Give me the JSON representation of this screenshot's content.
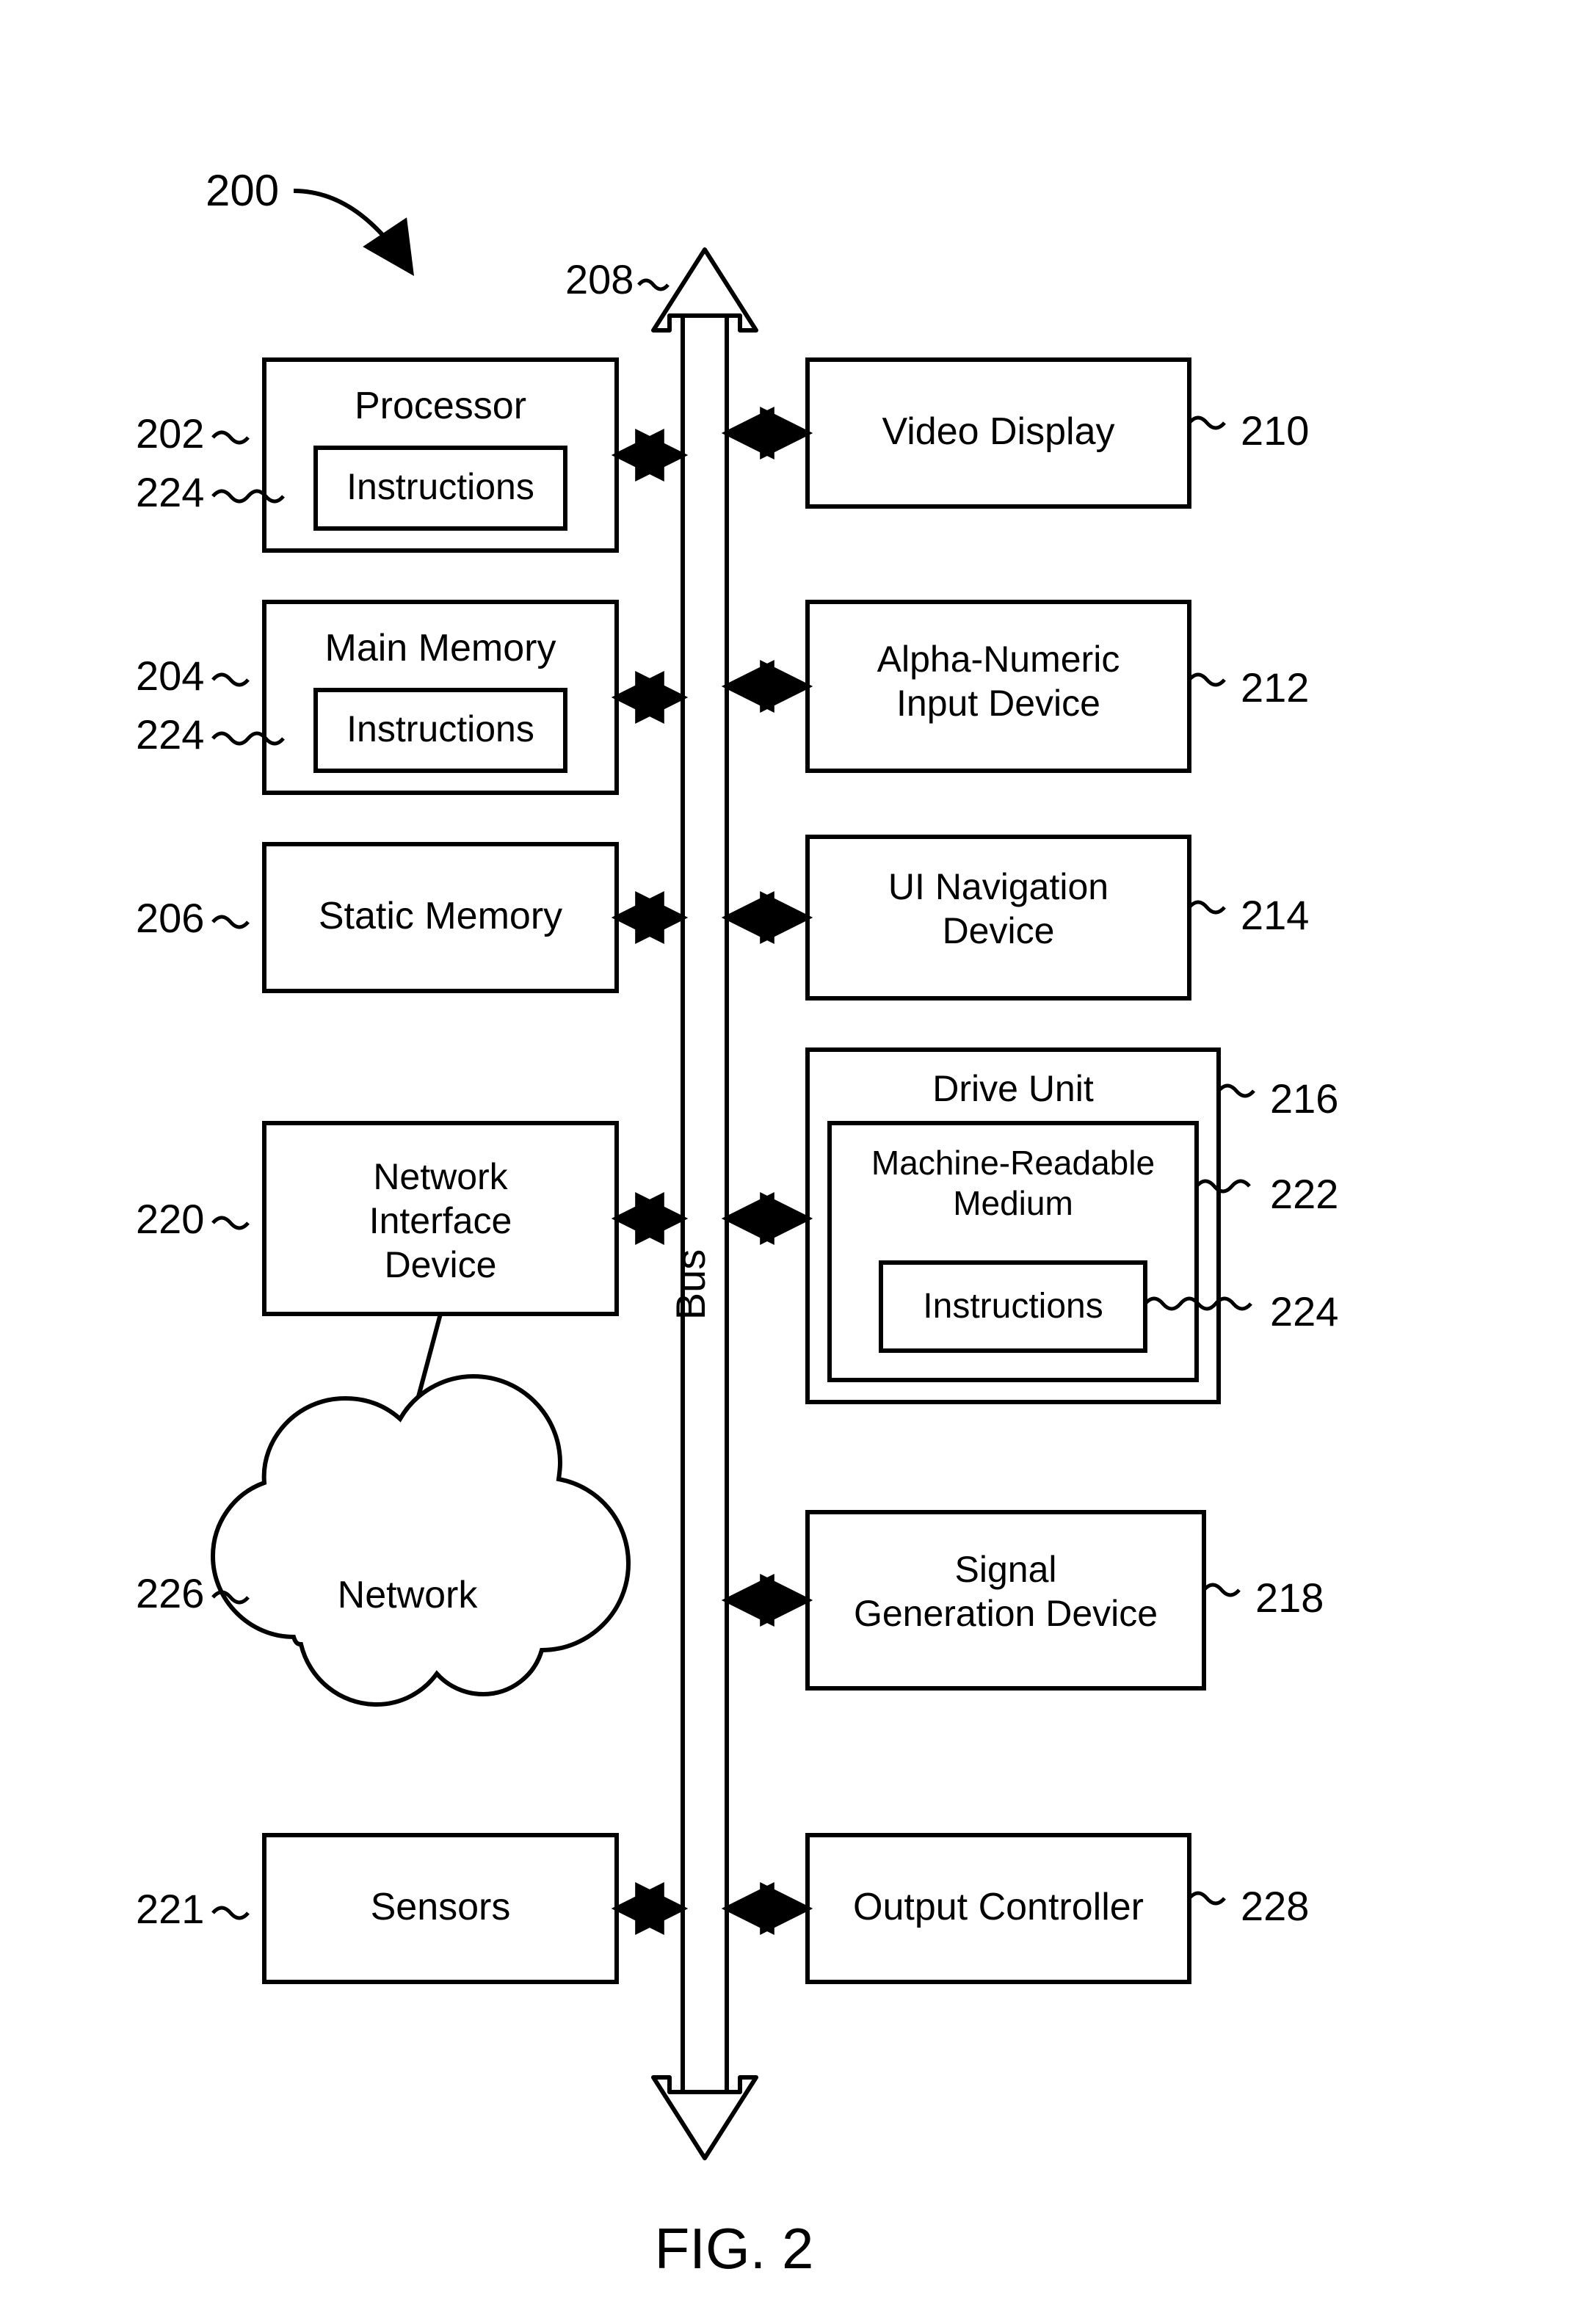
{
  "figure": {
    "caption": "FIG. 2",
    "ref_main": "200",
    "bus": {
      "label": "Bus",
      "ref": "208"
    }
  },
  "left": [
    {
      "key": "processor",
      "title": "Processor",
      "ref": "202",
      "inner": {
        "label": "Instructions",
        "ref": "224"
      }
    },
    {
      "key": "main_memory",
      "title": "Main Memory",
      "ref": "204",
      "inner": {
        "label": "Instructions",
        "ref": "224"
      }
    },
    {
      "key": "static_memory",
      "title": "Static Memory",
      "ref": "206"
    },
    {
      "key": "network_interface",
      "title": "Network Interface Device",
      "ref": "220",
      "multiline": true
    },
    {
      "key": "sensors",
      "title": "Sensors",
      "ref": "221"
    }
  ],
  "right": [
    {
      "key": "video_display",
      "title": "Video Display",
      "ref": "210"
    },
    {
      "key": "alpha_numeric",
      "title": "Alpha-Numeric Input Device",
      "ref": "212",
      "multiline": true
    },
    {
      "key": "ui_nav",
      "title": "UI Navigation Device",
      "ref": "214",
      "multiline": true
    },
    {
      "key": "drive_unit",
      "title": "Drive Unit",
      "ref": "216",
      "medium": {
        "title": "Machine-Readable Medium",
        "ref": "222",
        "instructions": {
          "label": "Instructions",
          "ref": "224"
        }
      }
    },
    {
      "key": "signal_gen",
      "title": "Signal Generation Device",
      "ref": "218",
      "multiline": true
    },
    {
      "key": "output_controller",
      "title": "Output Controller",
      "ref": "228"
    }
  ],
  "network": {
    "label": "Network",
    "ref": "226"
  }
}
